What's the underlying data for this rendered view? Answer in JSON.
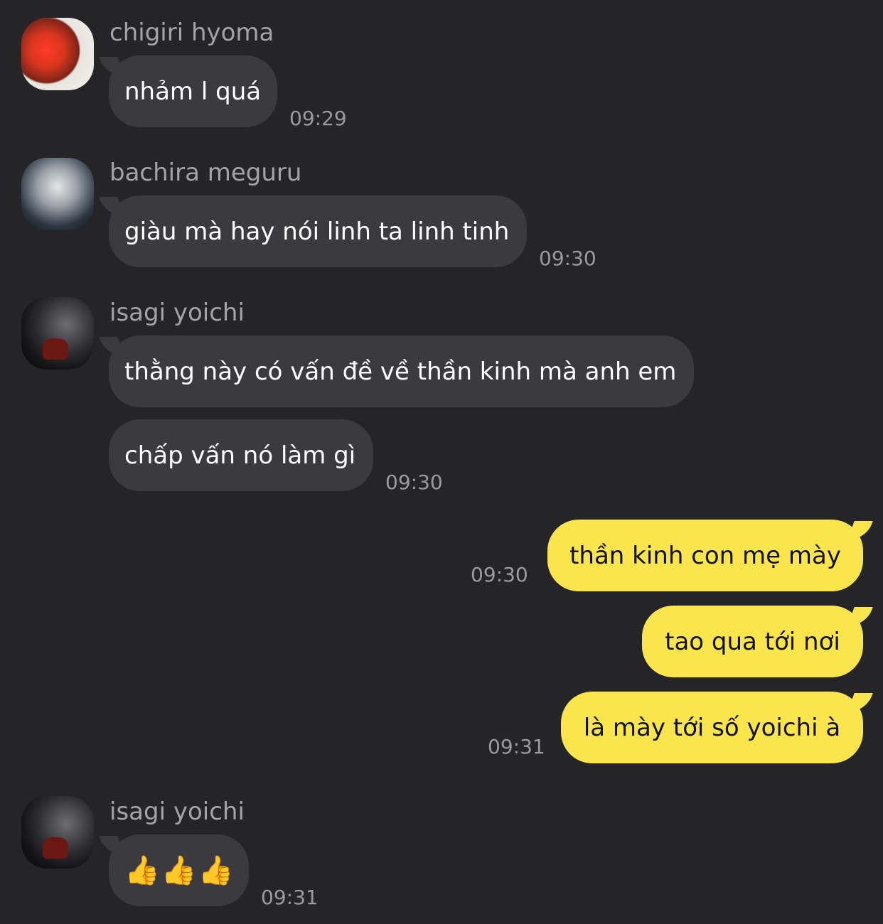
{
  "messages": [
    {
      "sender": "chigiri hyoma",
      "text": "nhảm l quá",
      "time": "09:29",
      "avatar": "chigiri-avatar"
    },
    {
      "sender": "bachira meguru",
      "text": "giàu mà hay nói linh ta linh tinh",
      "time": "09:30",
      "avatar": "bachira-avatar"
    },
    {
      "sender": "isagi yoichi",
      "text1": "thằng này có vấn đề về thần kinh mà anh em",
      "text2": "chấp vấn nó làm gì",
      "time": "09:30",
      "avatar": "isagi-avatar"
    },
    {
      "sender": "me",
      "text1": "thần kinh con mẹ mày",
      "time1": "09:30",
      "text2": "tao qua tới nơi",
      "text3": "là mày tới số yoichi à",
      "time2": "09:31"
    },
    {
      "sender": "isagi yoichi",
      "text": "👍👍👍",
      "time": "09:31",
      "avatar": "isagi-avatar"
    }
  ],
  "colors": {
    "background": "#252527",
    "incoming_bubble": "#3b3b3f",
    "outgoing_bubble": "#fae64c",
    "name_text": "#a4a4a8",
    "time_text": "#9b9b9f"
  }
}
